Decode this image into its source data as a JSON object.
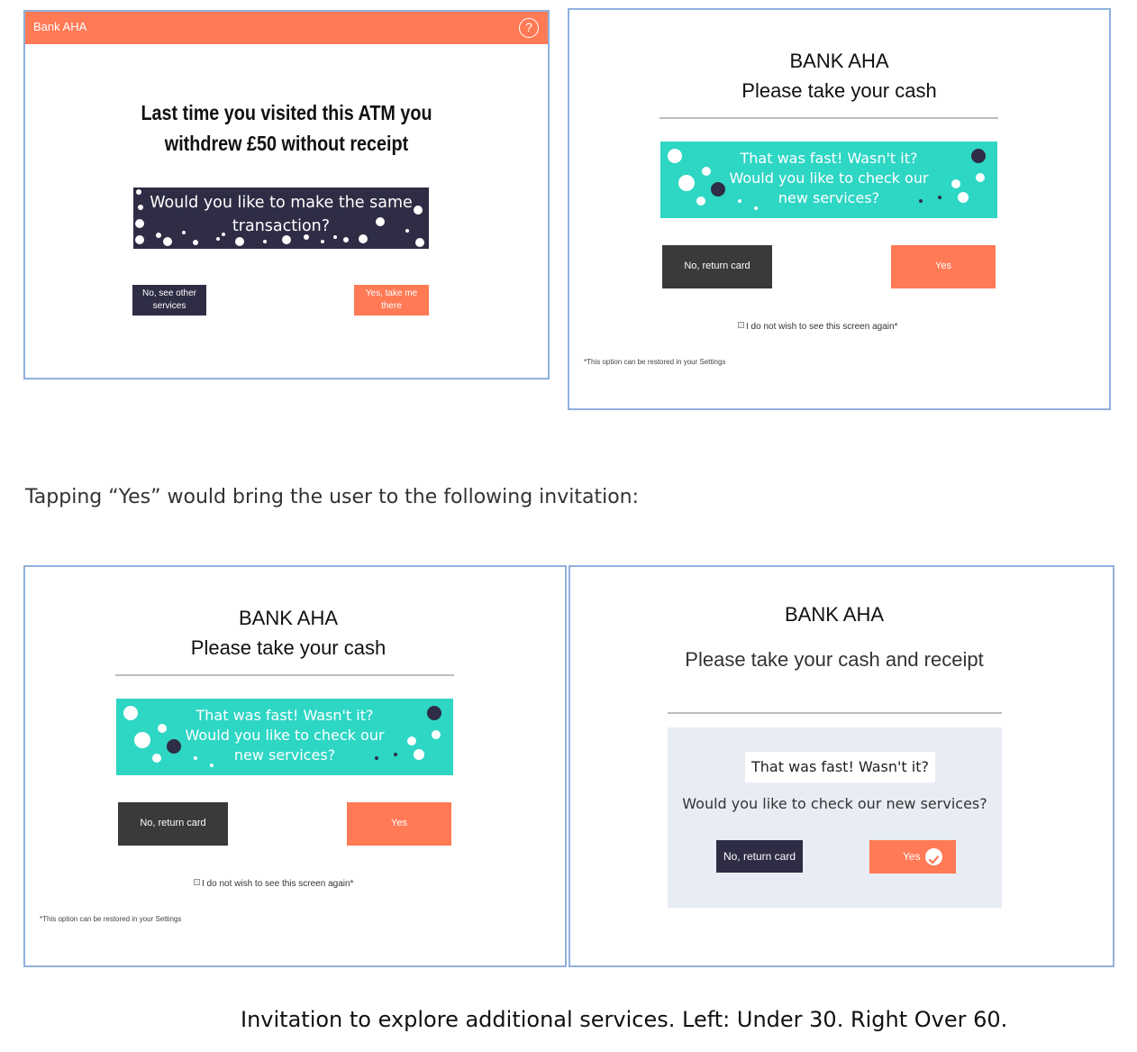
{
  "frame1": {
    "brand": "Bank AHA",
    "help_icon": "question-circle-icon",
    "help_glyph": "?",
    "headline_line1": "Last time you visited this ATM you",
    "headline_line2": "withdrew £50 without receipt",
    "question_line1": "Would you like to make the same",
    "question_line2": "transaction?",
    "no_button_line1": "No, see other",
    "no_button_line2": "services",
    "yes_button_line1": "Yes, take me",
    "yes_button_line2": "there",
    "colors": {
      "accent": "#ff7a55",
      "dark": "#2e2d45"
    }
  },
  "frame2": {
    "title": "BANK AHA",
    "subtitle": "Please take your cash",
    "promo_line1": "That was fast! Wasn't it?",
    "promo_line2": "Would you like to check our",
    "promo_line3": "new services?",
    "no_button": "No, return card",
    "yes_button": "Yes",
    "checkbox_label": "I do not wish to see this screen again*",
    "footnote": "*This option can be restored in your Settings",
    "colors": {
      "teal": "#2ed6c4",
      "orange": "#ff7a55",
      "dark": "#3a3a3a"
    }
  },
  "caption_middle": "Tapping “Yes” would bring the user to the following invitation:",
  "frame3": {
    "title": "BANK AHA",
    "subtitle": "Please take your cash",
    "promo_line1": "That was fast! Wasn't it?",
    "promo_line2": "Would you like to check our",
    "promo_line3": "new services?",
    "no_button": "No, return card",
    "yes_button": "Yes",
    "checkbox_label": "I do not wish to see this screen again*",
    "footnote": "*This option can be restored in your Settings"
  },
  "frame4": {
    "title": "BANK AHA",
    "subtitle": "Please take your cash and receipt",
    "pill": "That was fast! Wasn't it?",
    "question": "Would you like to check our new services?",
    "no_button": "No, return card",
    "yes_button": "Yes",
    "yes_icon": "checkmark-circle-icon",
    "colors": {
      "panel": "#e8ecf5"
    }
  },
  "caption_bottom": "Invitation to explore additional services. Left: Under 30. Right Over 60."
}
